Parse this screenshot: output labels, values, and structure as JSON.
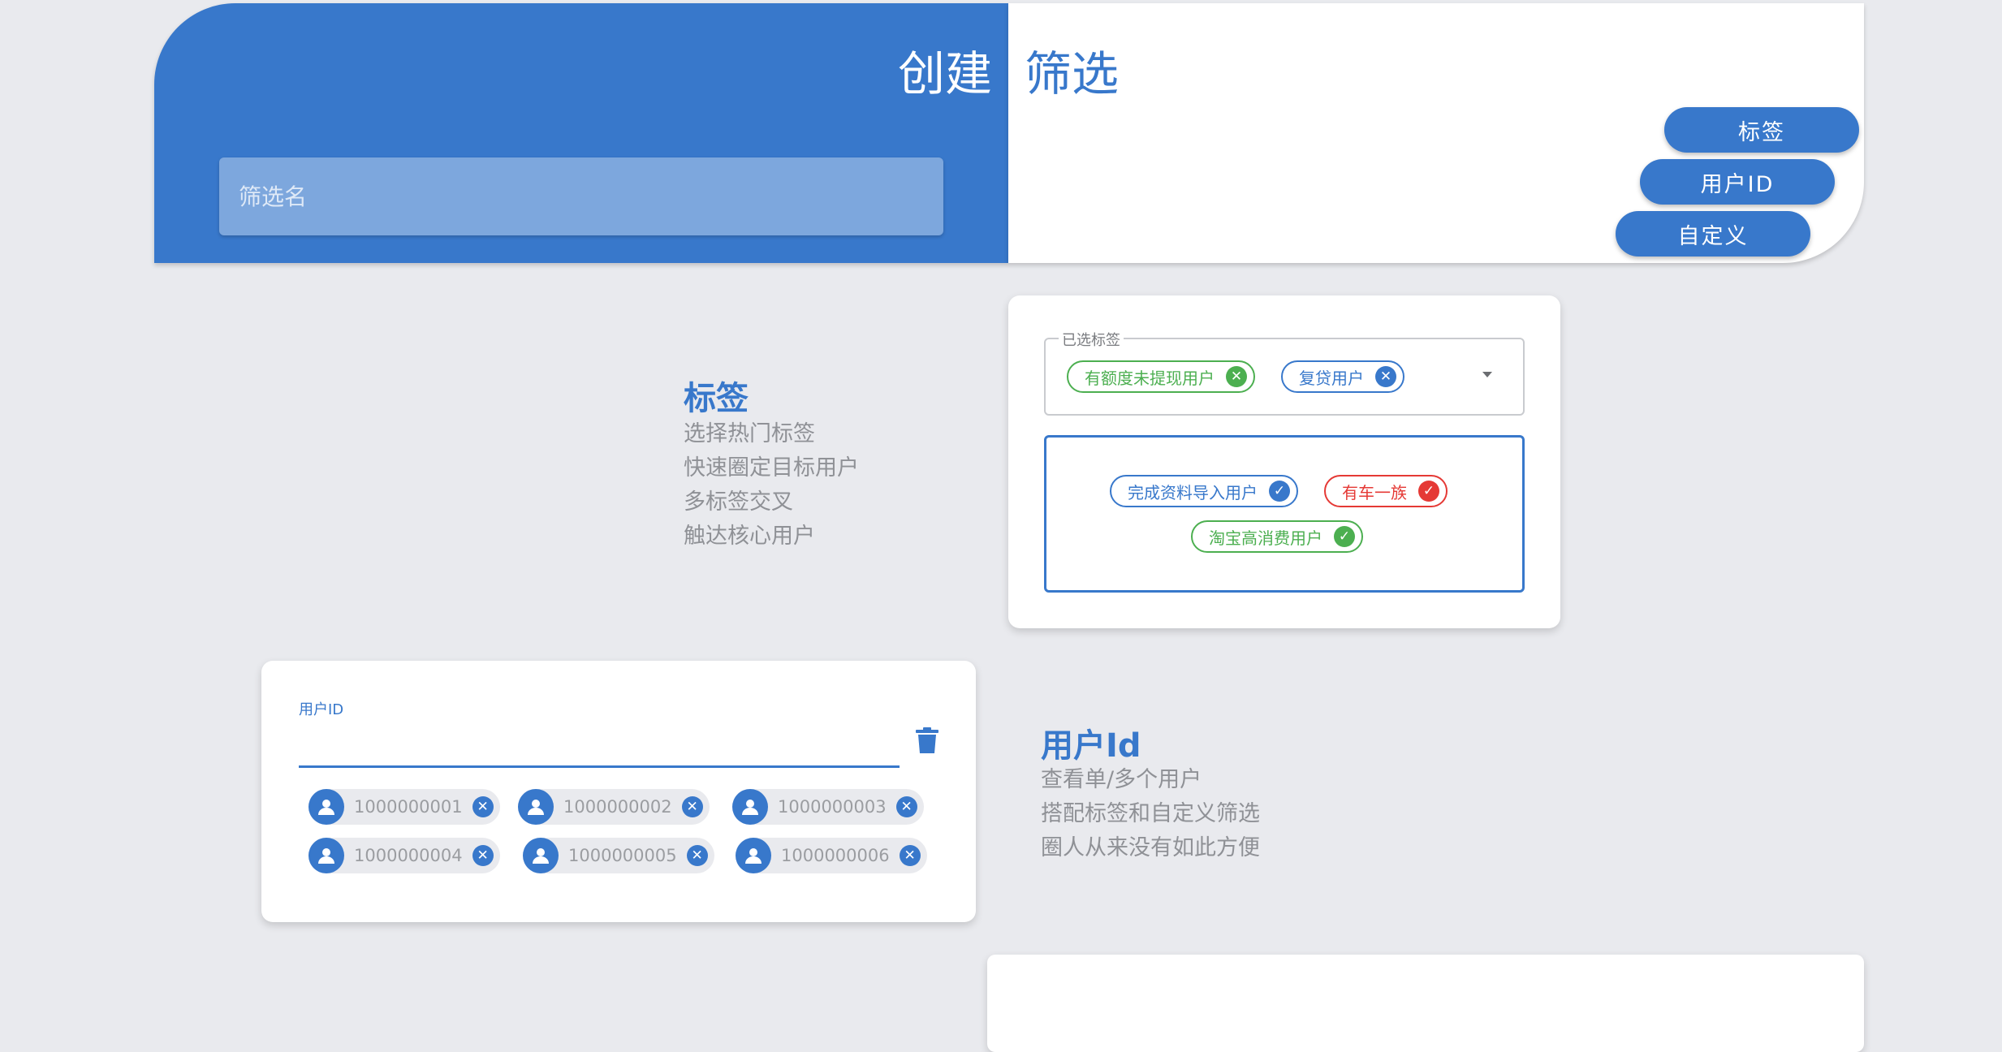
{
  "hero": {
    "title_left": "创建",
    "title_right": "筛选",
    "name_placeholder": "筛选名",
    "buttons": [
      "标签",
      "用户ID",
      "自定义"
    ]
  },
  "tags_section": {
    "title": "标签",
    "lines": [
      "选择热门标签",
      "快速圈定目标用户",
      "多标签交叉",
      "触达核心用户"
    ],
    "selected_legend": "已选标签",
    "selected_tags": [
      {
        "label": "有额度未提现用户",
        "color": "green",
        "icon": "close-icon"
      },
      {
        "label": "复贷用户",
        "color": "blue",
        "icon": "close-icon"
      }
    ],
    "available_tags": [
      {
        "label": "完成资料导入用户",
        "color": "blue",
        "icon": "check-icon"
      },
      {
        "label": "有车一族",
        "color": "red",
        "icon": "check-icon"
      },
      {
        "label": "淘宝高消费用户",
        "color": "green",
        "icon": "check-icon"
      }
    ]
  },
  "userid_section": {
    "title": "用户Id",
    "lines": [
      "查看单/多个用户",
      "搭配标签和自定义筛选",
      "圈人从来没有如此方便"
    ],
    "field_label": "用户ID",
    "user_ids": [
      "1000000001",
      "1000000002",
      "1000000003",
      "1000000004",
      "1000000005",
      "1000000006"
    ]
  },
  "colors": {
    "primary": "#3878cb",
    "green": "#4caf50",
    "red": "#e53935",
    "background": "#e9eaee"
  }
}
